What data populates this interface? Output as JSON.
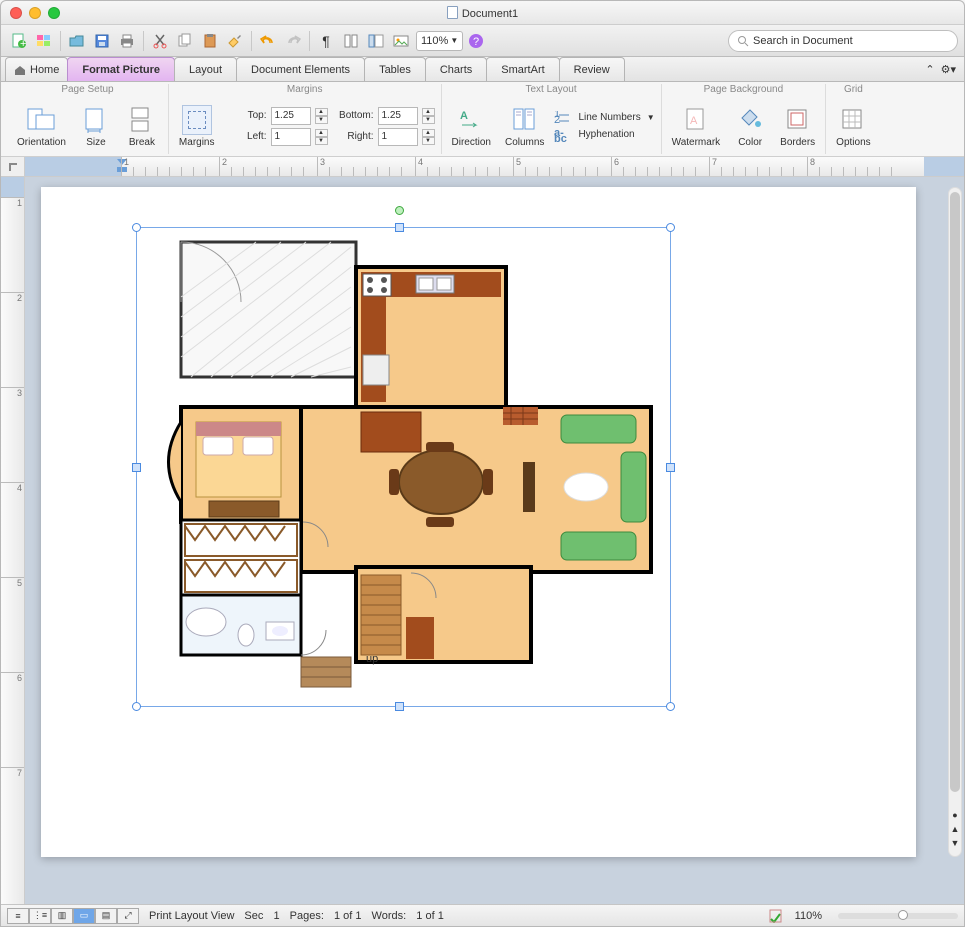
{
  "window": {
    "title": "Document1"
  },
  "toolbar": {
    "zoom": "110%",
    "search_placeholder": "Search in Document"
  },
  "tabs": {
    "home": "Home",
    "format_picture": "Format Picture",
    "layout": "Layout",
    "document_elements": "Document Elements",
    "tables": "Tables",
    "charts": "Charts",
    "smartart": "SmartArt",
    "review": "Review"
  },
  "ribbon": {
    "page_setup": {
      "label": "Page Setup",
      "orientation": "Orientation",
      "size": "Size",
      "break": "Break"
    },
    "margins": {
      "label": "Margins",
      "button": "Margins",
      "top_lbl": "Top:",
      "top": "1.25",
      "bottom_lbl": "Bottom:",
      "bottom": "1.25",
      "left_lbl": "Left:",
      "left": "1",
      "right_lbl": "Right:",
      "right": "1"
    },
    "text_layout": {
      "label": "Text Layout",
      "direction": "Direction",
      "columns": "Columns",
      "line_numbers": "Line Numbers",
      "hyphenation": "Hyphenation"
    },
    "page_bg": {
      "label": "Page Background",
      "watermark": "Watermark",
      "color": "Color",
      "borders": "Borders"
    },
    "grid": {
      "label": "Grid",
      "options": "Options"
    }
  },
  "ruler": {
    "marks": [
      "1",
      "2",
      "3",
      "4",
      "5",
      "6",
      "7",
      "8"
    ],
    "vmarks": [
      "1",
      "2",
      "3",
      "4",
      "5",
      "6",
      "7"
    ]
  },
  "status": {
    "view": "Print Layout View",
    "sec_lbl": "Sec",
    "sec": "1",
    "pages_lbl": "Pages:",
    "pages": "1 of 1",
    "words_lbl": "Words:",
    "words": "1 of 1",
    "zoom": "110%"
  },
  "floorplan": {
    "stairs_label": "up"
  }
}
